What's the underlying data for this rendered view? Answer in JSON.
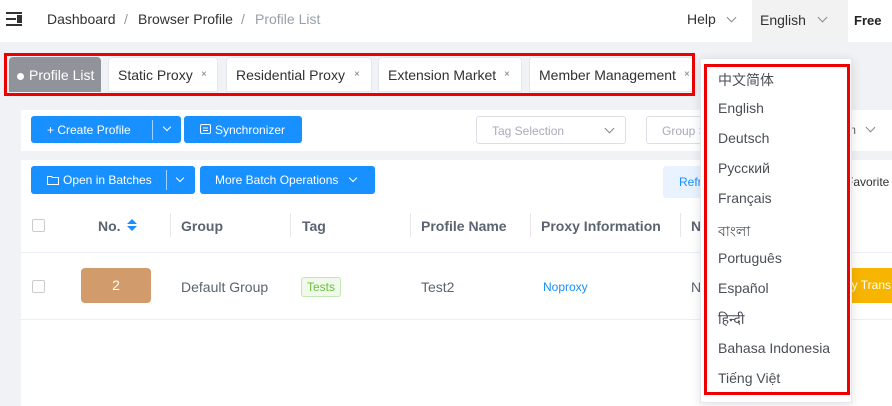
{
  "topbar": {
    "breadcrumb": [
      "Dashboard",
      "Browser Profile",
      "Profile List"
    ],
    "separator": "/",
    "help": "Help",
    "language": "English",
    "plan": "Free"
  },
  "tabs": [
    {
      "label": "Profile List",
      "active": true
    },
    {
      "label": "Static Proxy",
      "close": "×"
    },
    {
      "label": "Residential Proxy",
      "close": "×"
    },
    {
      "label": "Extension Market",
      "close": "×"
    },
    {
      "label": "Member Management",
      "close": "×"
    }
  ],
  "toolbar": {
    "create_profile": "+ Create Profile",
    "synchronizer": "Synchronizer",
    "tag_selection_placeholder": "Tag Selection",
    "group_placeholder": "Group S",
    "cut_label": "m"
  },
  "batch": {
    "open_in_batches": "Open in Batches",
    "more_batch": "More Batch Operations",
    "refresh": "Refr",
    "favorite": "Favorite"
  },
  "table": {
    "headers": [
      "No.",
      "Group",
      "Tag",
      "Profile Name",
      "Proxy Information",
      "N"
    ],
    "rows": [
      {
        "no": "2",
        "group": "Default Group",
        "tag": "Tests",
        "name": "Test2",
        "proxy": "Noproxy",
        "n": "N",
        "action": "py Trans"
      }
    ]
  },
  "language_menu": [
    "中文简体",
    "English",
    "Deutsch",
    "Русский",
    "Français",
    "বাংলা",
    "Português",
    "Español",
    "हिन्दी",
    "Bahasa Indonesia",
    "Tiếng Việt"
  ],
  "colors": {
    "primary": "#1890ff",
    "highlight": "#e00000",
    "badge": "#d19b6b",
    "tag_green": "#67c23a",
    "action_orange": "#f7b500"
  }
}
